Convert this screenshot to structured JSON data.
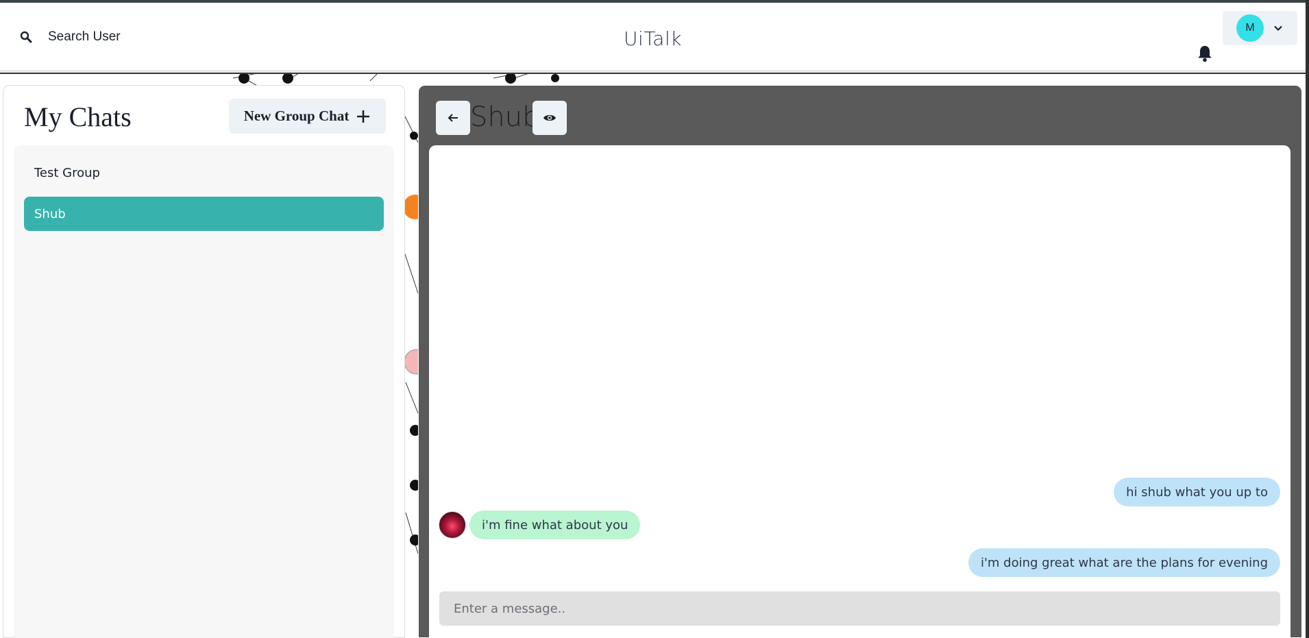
{
  "header": {
    "search_label": "Search User",
    "app_title": "UiTalk",
    "profile_initial": "M"
  },
  "chats": {
    "title": "My Chats",
    "new_group_label": "New Group Chat",
    "items": [
      {
        "label": "Test Group",
        "active": false
      },
      {
        "label": "Shub",
        "active": true
      }
    ]
  },
  "conversation": {
    "name": "Shub",
    "messages": [
      {
        "text": "hi shub what you up to",
        "direction": "outgoing"
      },
      {
        "text": "i'm fine what about you",
        "direction": "incoming"
      },
      {
        "text": "i'm doing great what are the plans for evening",
        "direction": "outgoing"
      }
    ],
    "input_placeholder": "Enter a message.."
  },
  "colors": {
    "accent": "#38b2ac",
    "outgoing_bubble": "#bee3f8",
    "incoming_bubble": "#b9f5d0",
    "avatar_bg": "#34e0e8"
  },
  "icons": {
    "search": "search-icon",
    "bell": "bell-icon",
    "chevron": "chevron-down-icon",
    "add": "plus-icon",
    "back": "arrow-left-icon",
    "view": "eye-icon"
  }
}
